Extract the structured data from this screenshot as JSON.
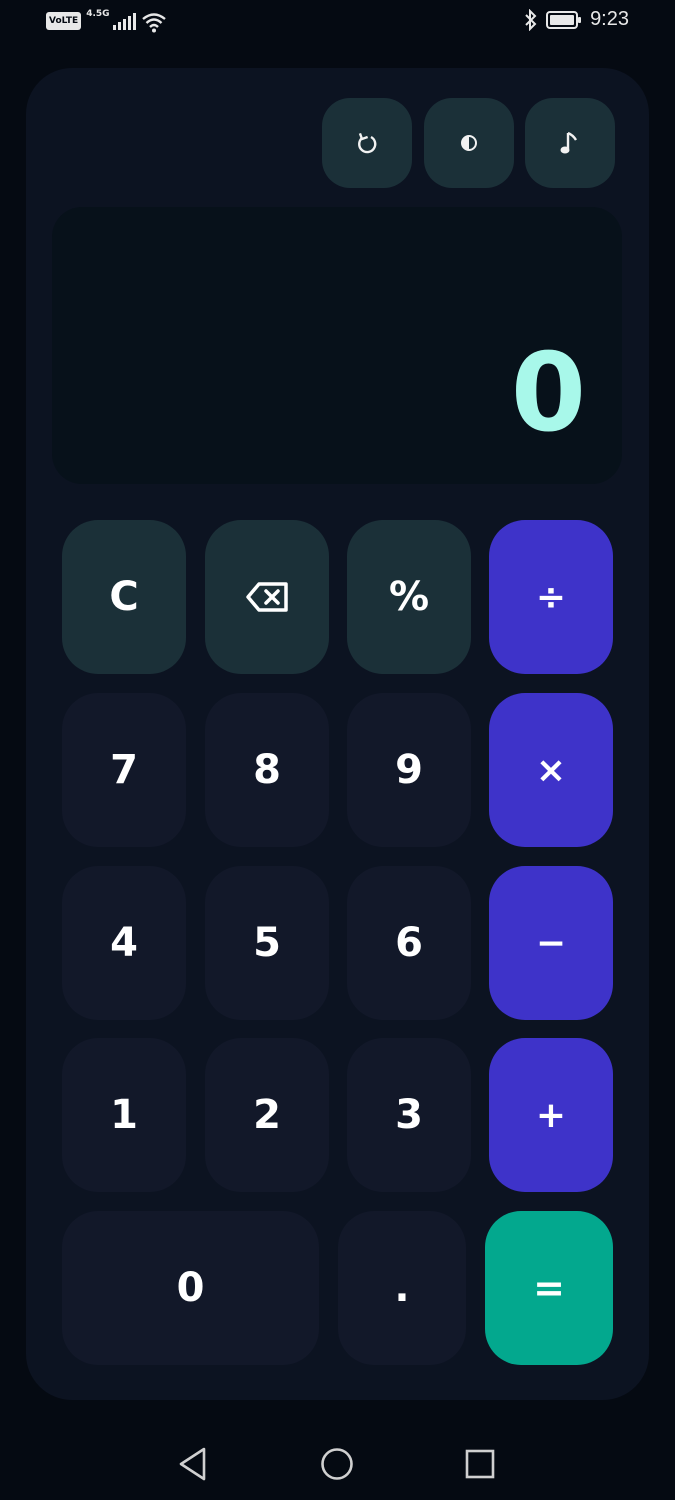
{
  "status_bar": {
    "volte": "VoLTE",
    "network": "4.5G",
    "time": "9:23"
  },
  "toolbar": {
    "history_icon": "history-icon",
    "theme_icon": "theme-toggle-icon",
    "sound_icon": "sound-icon"
  },
  "display": {
    "value": "0"
  },
  "keypad": {
    "row1": [
      "C",
      "⌫",
      "%",
      "÷"
    ],
    "row2": [
      "7",
      "8",
      "9",
      "×"
    ],
    "row3": [
      "4",
      "5",
      "6",
      "−"
    ],
    "row4": [
      "1",
      "2",
      "3",
      "+"
    ],
    "row5": [
      "0",
      ".",
      "="
    ]
  },
  "colors": {
    "background": "#050a12",
    "card": "#0c1321",
    "function_key": "#1b3038",
    "digit_key": "#121829",
    "operator_key": "#3e33c9",
    "equals_key": "#03a88e",
    "display_text": "#a8f8ea"
  }
}
